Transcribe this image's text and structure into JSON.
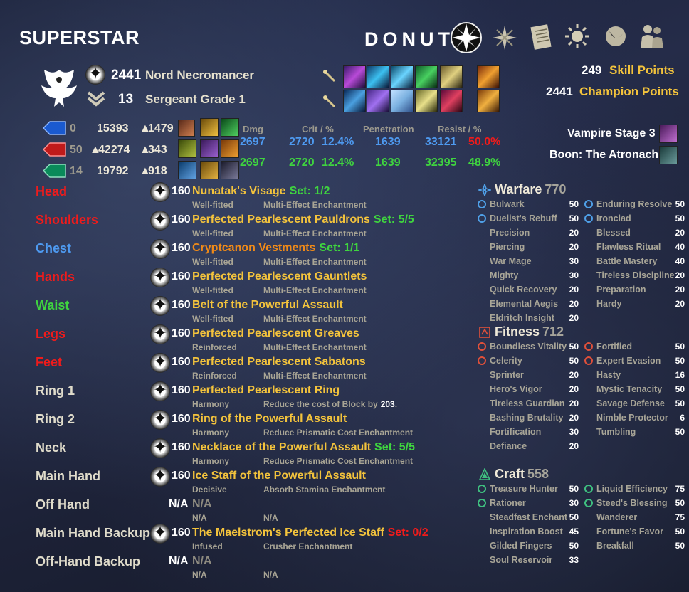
{
  "header": {
    "character_name": "SUPERSTAR",
    "account_name": "DONUT"
  },
  "nav_icons": [
    "champion-star-icon",
    "skills-icon",
    "scroll-icon",
    "sun-icon",
    "hourglass-icon",
    "group-icon"
  ],
  "character": {
    "cp_level": "2441",
    "race_class": "Nord Necromancer",
    "rank": "13",
    "rank_title": "Sergeant Grade 1",
    "skill_points_value": "249",
    "skill_points_label": "Skill Points",
    "champion_points_value": "2441",
    "champion_points_label": "Champion Points",
    "vampire": "Vampire Stage 3",
    "boon": "Boon: The Atronach"
  },
  "attributes": [
    {
      "points": "0",
      "max": "15393",
      "regen": "1479"
    },
    {
      "points": "50",
      "max": "42274",
      "regen": "343"
    },
    {
      "points": "14",
      "max": "19792",
      "regen": "918"
    }
  ],
  "stats_headers": {
    "dmg": "Dmg",
    "crit": "Crit / %",
    "pen": "Penetration",
    "resist": "Resist / %"
  },
  "stats": [
    {
      "dmg": "2697",
      "crit": "2720",
      "crit_pct": "12.4%",
      "pen": "1639",
      "resist": "33121",
      "resist_pct": "50.0%"
    },
    {
      "dmg": "2697",
      "crit": "2720",
      "crit_pct": "12.4%",
      "pen": "1639",
      "resist": "32395",
      "resist_pct": "48.9%"
    }
  ],
  "gear": [
    {
      "slot": "Head",
      "level": "160",
      "name": "Nunatak's Visage",
      "set": "Set: 1/2",
      "trait": "Well-fitted",
      "enchant": "Multi-Effect Enchantment"
    },
    {
      "slot": "Shoulders",
      "level": "160",
      "name": "Perfected Pearlescent Pauldrons",
      "set": "Set: 5/5",
      "trait": "Well-fitted",
      "enchant": "Multi-Effect Enchantment"
    },
    {
      "slot": "Chest",
      "level": "160",
      "name": "Cryptcanon Vestments",
      "set": "Set: 1/1",
      "trait": "Well-fitted",
      "enchant": "Multi-Effect Enchantment"
    },
    {
      "slot": "Hands",
      "level": "160",
      "name": "Perfected Pearlescent Gauntlets",
      "set": "",
      "trait": "Well-fitted",
      "enchant": "Multi-Effect Enchantment"
    },
    {
      "slot": "Waist",
      "level": "160",
      "name": "Belt of the Powerful Assault",
      "set": "",
      "trait": "Well-fitted",
      "enchant": "Multi-Effect Enchantment"
    },
    {
      "slot": "Legs",
      "level": "160",
      "name": "Perfected Pearlescent Greaves",
      "set": "",
      "trait": "Reinforced",
      "enchant": "Multi-Effect Enchantment"
    },
    {
      "slot": "Feet",
      "level": "160",
      "name": "Perfected Pearlescent Sabatons",
      "set": "",
      "trait": "Reinforced",
      "enchant": "Multi-Effect Enchantment"
    },
    {
      "slot": "Ring 1",
      "level": "160",
      "name": "Perfected Pearlescent Ring",
      "set": "",
      "trait": "Harmony",
      "enchant": "Reduce the cost of Block by",
      "enchant_value": "203",
      "enchant_suffix": "."
    },
    {
      "slot": "Ring 2",
      "level": "160",
      "name": "Ring of the Powerful Assault",
      "set": "",
      "trait": "Harmony",
      "enchant": "Reduce Prismatic Cost Enchantment"
    },
    {
      "slot": "Neck",
      "level": "160",
      "name": "Necklace of the Powerful Assault",
      "set": "Set: 5/5",
      "trait": "Harmony",
      "enchant": "Reduce Prismatic Cost Enchantment"
    },
    {
      "slot": "Main Hand",
      "level": "160",
      "name": "Ice Staff of the Powerful Assault",
      "set": "",
      "trait": "Decisive",
      "enchant": "Absorb Stamina Enchantment"
    },
    {
      "slot": "Off Hand",
      "level": "N/A",
      "name": "N/A",
      "set": "",
      "trait": "N/A",
      "enchant": "N/A"
    },
    {
      "slot": "Main Hand Backup",
      "level": "160",
      "name": "The Maelstrom's Perfected Ice Staff",
      "set": "Set: 0/2",
      "trait": "Infused",
      "enchant": "Crusher Enchantment"
    },
    {
      "slot": "Off-Hand Backup",
      "level": "N/A",
      "name": "N/A",
      "set": "",
      "trait": "N/A",
      "enchant": "N/A"
    }
  ],
  "cp_trees": {
    "warfare": {
      "title": "Warfare",
      "points": "770",
      "left": [
        [
          "Bulwark",
          "50"
        ],
        [
          "Duelist's Rebuff",
          "50"
        ],
        [
          "Precision",
          "20"
        ],
        [
          "Piercing",
          "20"
        ],
        [
          "War Mage",
          "30"
        ],
        [
          "Mighty",
          "30"
        ],
        [
          "Quick Recovery",
          "20"
        ],
        [
          "Elemental Aegis",
          "20"
        ],
        [
          "Eldritch Insight",
          "20"
        ]
      ],
      "right": [
        [
          "Enduring Resolve",
          "50"
        ],
        [
          "Ironclad",
          "50"
        ],
        [
          "Blessed",
          "20"
        ],
        [
          "Flawless Ritual",
          "40"
        ],
        [
          "Battle Mastery",
          "40"
        ],
        [
          "Tireless Discipline",
          "20"
        ],
        [
          "Preparation",
          "20"
        ],
        [
          "Hardy",
          "20"
        ]
      ]
    },
    "fitness": {
      "title": "Fitness",
      "points": "712",
      "left": [
        [
          "Boundless Vitality",
          "50"
        ],
        [
          "Celerity",
          "50"
        ],
        [
          "Sprinter",
          "20"
        ],
        [
          "Hero's Vigor",
          "20"
        ],
        [
          "Tireless Guardian",
          "20"
        ],
        [
          "Bashing Brutality",
          "20"
        ],
        [
          "Fortification",
          "30"
        ],
        [
          "Defiance",
          "20"
        ]
      ],
      "right": [
        [
          "Fortified",
          "50"
        ],
        [
          "Expert Evasion",
          "50"
        ],
        [
          "Hasty",
          "16"
        ],
        [
          "Mystic Tenacity",
          "50"
        ],
        [
          "Savage Defense",
          "50"
        ],
        [
          "Nimble Protector",
          "6"
        ],
        [
          "Tumbling",
          "50"
        ]
      ]
    },
    "craft": {
      "title": "Craft",
      "points": "558",
      "left": [
        [
          "Treasure Hunter",
          "50"
        ],
        [
          "Rationer",
          "30"
        ],
        [
          "Steadfast Enchant",
          "50"
        ],
        [
          "Inspiration Boost",
          "45"
        ],
        [
          "Gilded Fingers",
          "50"
        ],
        [
          "Soul Reservoir",
          "33"
        ]
      ],
      "right": [
        [
          "Liquid Efficiency",
          "75"
        ],
        [
          "Steed's Blessing",
          "50"
        ],
        [
          "Wanderer",
          "75"
        ],
        [
          "Fortune's Favor",
          "50"
        ],
        [
          "Breakfall",
          "50"
        ]
      ]
    }
  },
  "colors": {
    "gold": "#f3c33c",
    "set_green": "#3fd43f",
    "red": "#f01b1b",
    "blue": "#4e9af0",
    "orange": "#f08a18"
  }
}
